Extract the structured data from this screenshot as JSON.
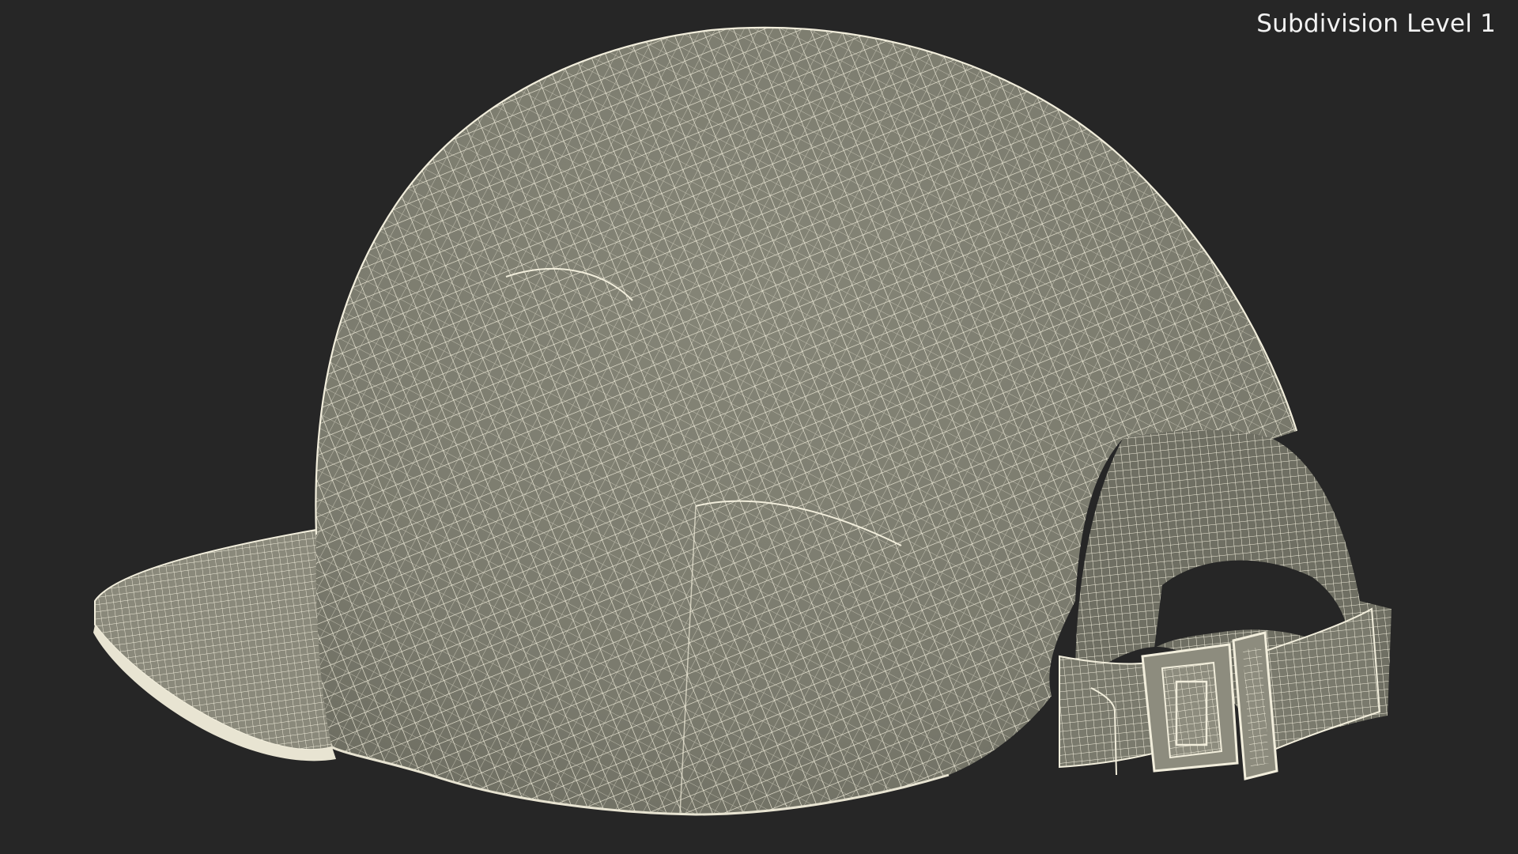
{
  "viewport": {
    "overlay_label": "Subdivision Level 1",
    "background_color": "#262626",
    "surface_color": "#7b7b6e",
    "wire_color": "#f2eedc",
    "object": "cap-wireframe"
  }
}
